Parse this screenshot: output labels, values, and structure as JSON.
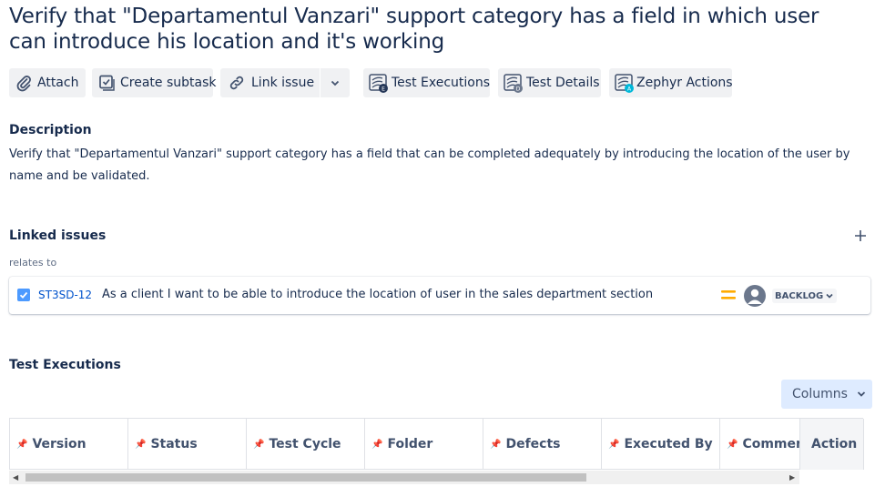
{
  "issue": {
    "title": "Verify that \"Departamentul Vanzari\" support category has a field in which user can introduce his location and it's working"
  },
  "toolbar": {
    "attach": "Attach",
    "create_subtask": "Create subtask",
    "link_issue": "Link issue",
    "test_executions": "Test Executions",
    "test_details": "Test Details",
    "zephyr_actions": "Zephyr Actions"
  },
  "description": {
    "heading": "Description",
    "text": "Verify that \"Departamentul Vanzari\" support category has a field that can be completed adequately by introducing the location of the user by name and be validated."
  },
  "linked_issues": {
    "heading": "Linked issues",
    "relation": "relates to",
    "items": [
      {
        "key": "ST3SD-12",
        "summary": "As a client I want to be able to introduce the location of user in the sales department section",
        "status": "BACKLOG",
        "priority": "medium",
        "priority_color": "#ffab00"
      }
    ]
  },
  "test_executions": {
    "heading": "Test Executions",
    "columns_button": "Columns",
    "columns": [
      "Version",
      "Status",
      "Test Cycle",
      "Folder",
      "Defects",
      "Executed By",
      "Comment",
      "Action"
    ]
  },
  "colors": {
    "text": "#172b4d",
    "link": "#0052cc",
    "button_bg": "#f0f1f3",
    "columns_bg": "#deebff",
    "checkbox": "#4c9aff"
  }
}
